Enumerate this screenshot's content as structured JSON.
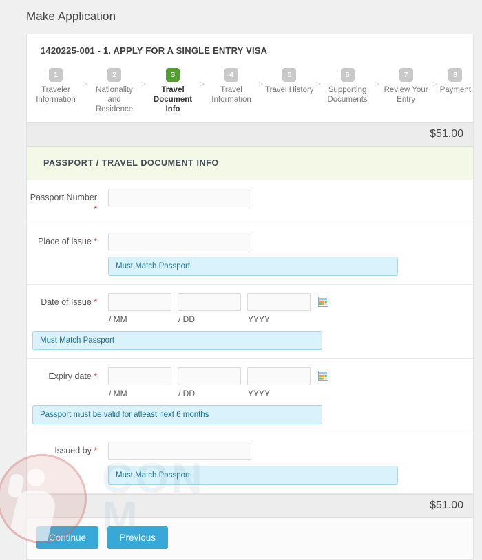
{
  "page": {
    "title": "Make Application",
    "application_header": "1420225-001 - 1. APPLY FOR A SINGLE ENTRY VISA",
    "price": "$51.00",
    "price_bottom": "$51.00",
    "section_title": "PASSPORT / TRAVEL DOCUMENT INFO",
    "watermark_text_line1": "CON",
    "watermark_text_line2": "M"
  },
  "colors": {
    "active_step": "#529e2e",
    "inactive_step": "#c9c9c9",
    "button": "#37a8d8",
    "hint_bg": "#d9f2fb",
    "hint_border": "#9fd9ee",
    "hint_text": "#1f6f8b",
    "section_bg": "#f3f8e7",
    "required_star": "#ee3333",
    "page_bg": "#f0f0f0"
  },
  "wizard": {
    "separator": ">",
    "steps": [
      {
        "number": "1",
        "label": "Traveler Information",
        "active": false
      },
      {
        "number": "2",
        "label": "Nationality and Residence",
        "active": false
      },
      {
        "number": "3",
        "label": "Travel Document Info",
        "active": true
      },
      {
        "number": "4",
        "label": "Travel Information",
        "active": false
      },
      {
        "number": "5",
        "label": "Travel History",
        "active": false
      },
      {
        "number": "6",
        "label": "Supporting Documents",
        "active": false
      },
      {
        "number": "7",
        "label": "Review Your Entry",
        "active": false
      },
      {
        "number": "8",
        "label": "Payment",
        "active": false
      }
    ]
  },
  "form": {
    "passport_number": {
      "label": "Passport Number",
      "required_mark": "*",
      "value": "",
      "placeholder": ""
    },
    "place_of_issue": {
      "label": "Place of issue",
      "required_mark": "*",
      "value": "",
      "placeholder": "",
      "hint": "Must Match Passport"
    },
    "date_of_issue": {
      "label": "Date of Issue",
      "required_mark": "*",
      "mm_value": "",
      "mm_hint": "/ MM",
      "dd_value": "",
      "dd_hint": "/ DD",
      "yyyy_value": "",
      "yyyy_hint": "YYYY",
      "calendar_icon": "calendar-icon",
      "hint": "Must Match Passport"
    },
    "expiry_date": {
      "label": "Expiry date",
      "required_mark": "*",
      "mm_value": "",
      "mm_hint": "/ MM",
      "dd_value": "",
      "dd_hint": "/ DD",
      "yyyy_value": "",
      "yyyy_hint": "YYYY",
      "calendar_icon": "calendar-icon",
      "hint": "Passport must be valid for atleast next 6 months"
    },
    "issued_by": {
      "label": "Issued by",
      "required_mark": "*",
      "value": "",
      "placeholder": "",
      "hint": "Must Match Passport"
    }
  },
  "footer": {
    "continue_label": "Continue",
    "previous_label": "Previous"
  }
}
